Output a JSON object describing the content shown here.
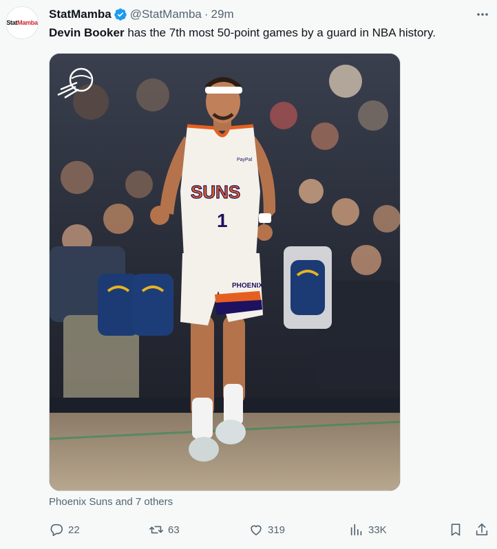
{
  "author": {
    "avatar_text_a": "Stat",
    "avatar_text_b": "Mamba",
    "display_name": "StatMamba",
    "handle": "@StatMamba",
    "separator": "·",
    "time": "29m",
    "verified": true
  },
  "tweet": {
    "bold_lead": "Devin Booker",
    "text_rest": " has the 7th most 50-point games by a guard in NBA history."
  },
  "media": {
    "jersey_text": "SUNS",
    "jersey_number": "1",
    "shorts_text": "PHOENIX",
    "sponsor_text": "PayPal",
    "icon": "suns-logo-icon"
  },
  "tagged": "Phoenix Suns and 7 others",
  "actions": {
    "reply_count": "22",
    "retweet_count": "63",
    "like_count": "319",
    "views_count": "33K"
  },
  "colors": {
    "suns_orange": "#e56020",
    "suns_purple": "#1d1160",
    "verified_blue": "#1d9bf0",
    "muted": "#536471"
  }
}
